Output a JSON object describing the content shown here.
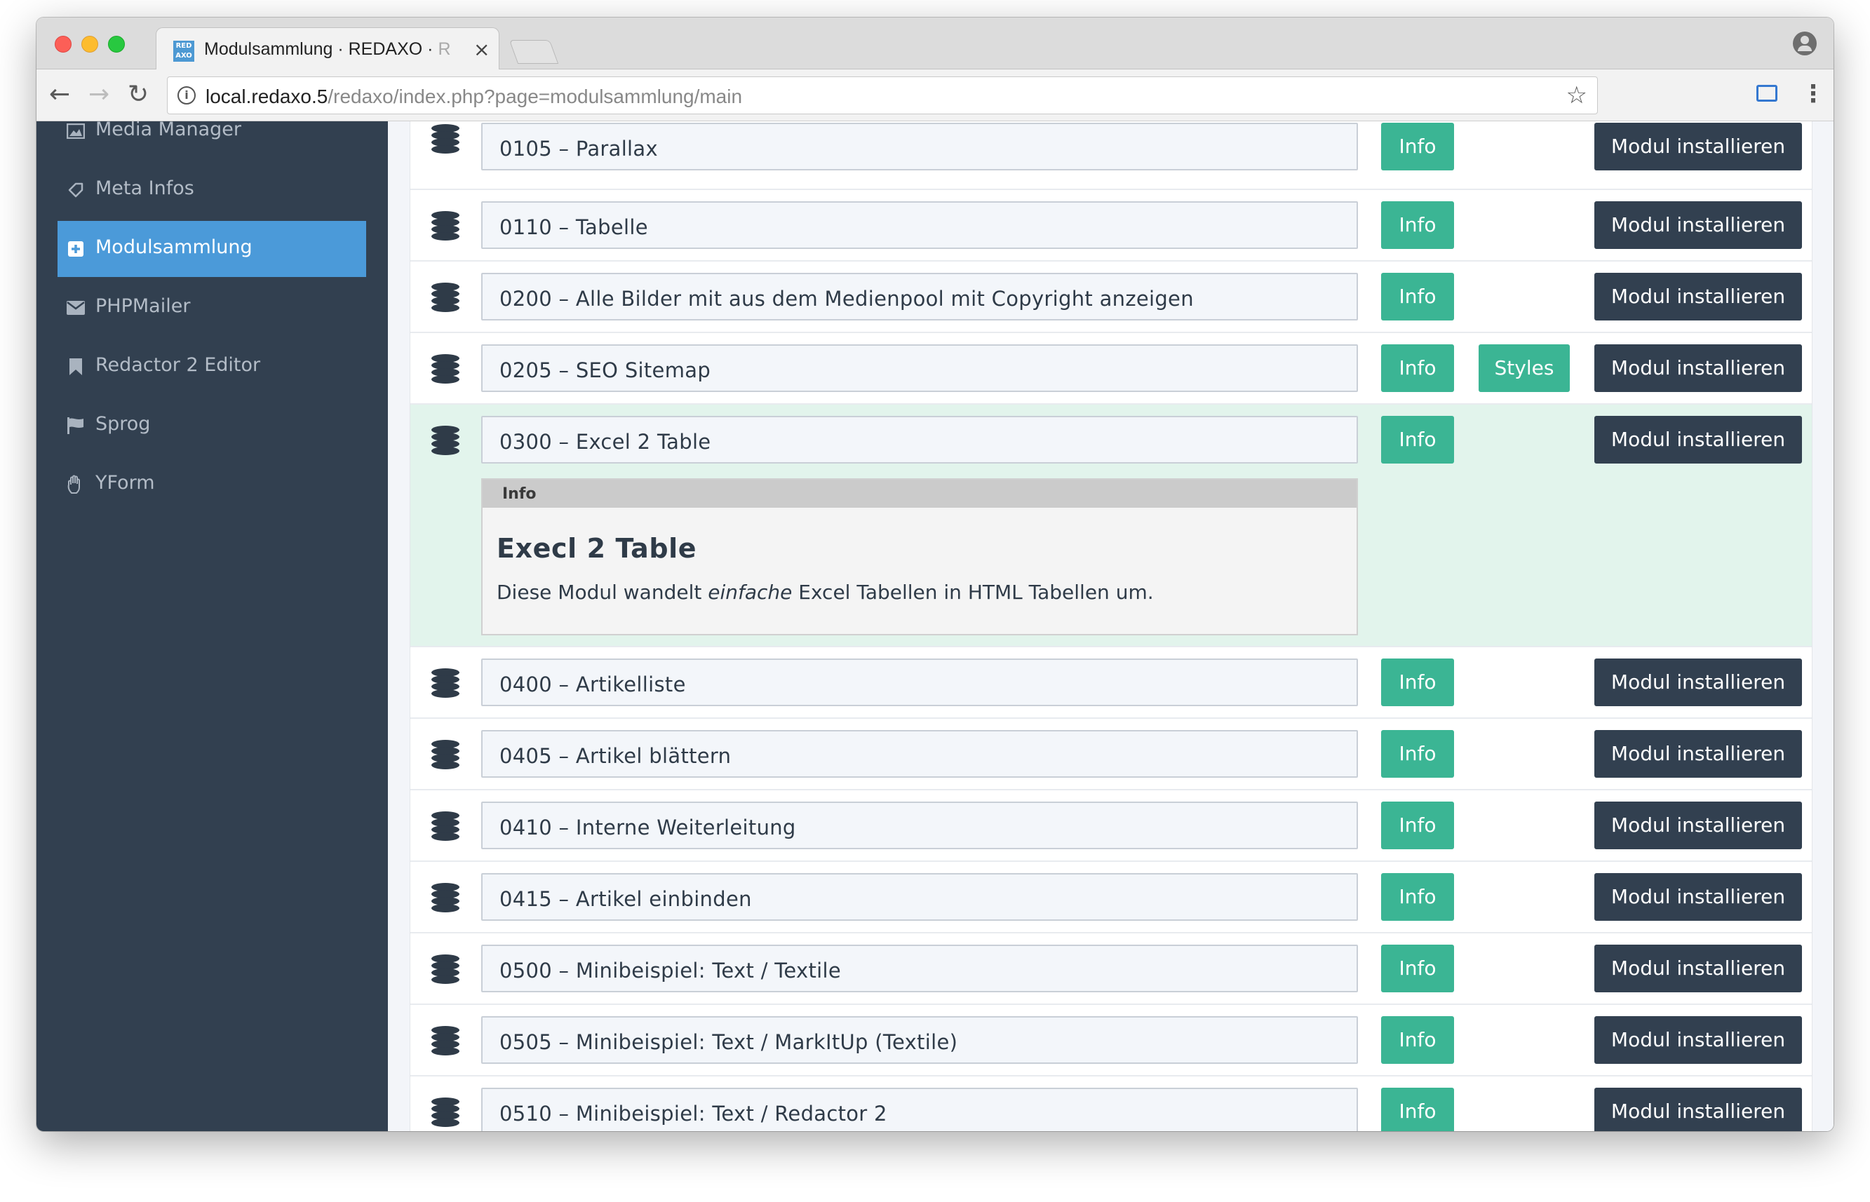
{
  "browser": {
    "tab_title": "Modulsammlung · REDAXO · ",
    "tab_title_faded": "R",
    "favicon_text": "RED AXO",
    "tab_close": "×",
    "url_host": "local.redaxo.5",
    "url_path": "/redaxo/index.php?page=modulsammlung/main"
  },
  "sidebar": {
    "items": [
      {
        "label": "Media Manager",
        "icon": "image-icon",
        "active": false
      },
      {
        "label": "Meta Infos",
        "icon": "tag-icon",
        "active": false
      },
      {
        "label": "Modulsammlung",
        "icon": "plus-square-icon",
        "active": true
      },
      {
        "label": "PHPMailer",
        "icon": "envelope-icon",
        "active": false
      },
      {
        "label": "Redactor 2 Editor",
        "icon": "bookmark-icon",
        "active": false
      },
      {
        "label": "Sprog",
        "icon": "flag-icon",
        "active": false
      },
      {
        "label": "YForm",
        "icon": "hand-icon",
        "active": false
      }
    ]
  },
  "modules": {
    "info_label": "Info",
    "styles_label": "Styles",
    "install_label": "Modul installieren",
    "rows": [
      {
        "name": "0105 – Parallax"
      },
      {
        "name": "0110 – Tabelle"
      },
      {
        "name": "0200 – Alle Bilder mit aus dem Medienpool mit Copyright anzeigen"
      },
      {
        "name": "0205 – SEO Sitemap",
        "has_styles": true
      },
      {
        "name": "0300 – Excel 2 Table",
        "expanded": true
      },
      {
        "name": "0400 – Artikelliste"
      },
      {
        "name": "0405 – Artikel blättern"
      },
      {
        "name": "0410 – Interne Weiterleitung"
      },
      {
        "name": "0415 – Artikel einbinden"
      },
      {
        "name": "0500 – Minibeispiel: Text / Textile"
      },
      {
        "name": "0505 – Minibeispiel: Text / MarkItUp (Textile)"
      },
      {
        "name": "0510 – Minibeispiel: Text / Redactor 2"
      }
    ],
    "info_panel": {
      "header": "Info",
      "title": "Execl 2 Table",
      "desc_before": "Diese Modul wandelt ",
      "desc_em": "einfache",
      "desc_after": " Excel Tabellen in HTML Tabellen um."
    }
  },
  "colors": {
    "sidebar_bg": "#324050",
    "active_item": "#4b9ad9",
    "info_button": "#3bb594",
    "install_button": "#324050",
    "highlight_row": "#e2f4ec"
  }
}
